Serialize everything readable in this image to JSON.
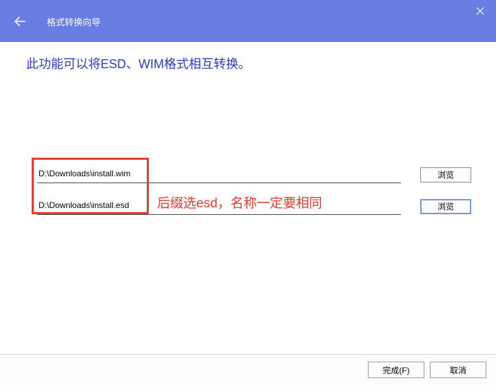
{
  "titlebar": {
    "title": "格式转换向导"
  },
  "heading": "此功能可以将ESD、WIM格式相互转换。",
  "rows": {
    "source": {
      "value": "D:\\Downloads\\install.wim",
      "browse_label": "浏览"
    },
    "target": {
      "value": "D:\\Downloads\\install.esd",
      "browse_label": "浏览"
    }
  },
  "annotation": "后缀选esd，名称一定要相同",
  "footer": {
    "finish": "完成(F)",
    "cancel": "取消"
  }
}
